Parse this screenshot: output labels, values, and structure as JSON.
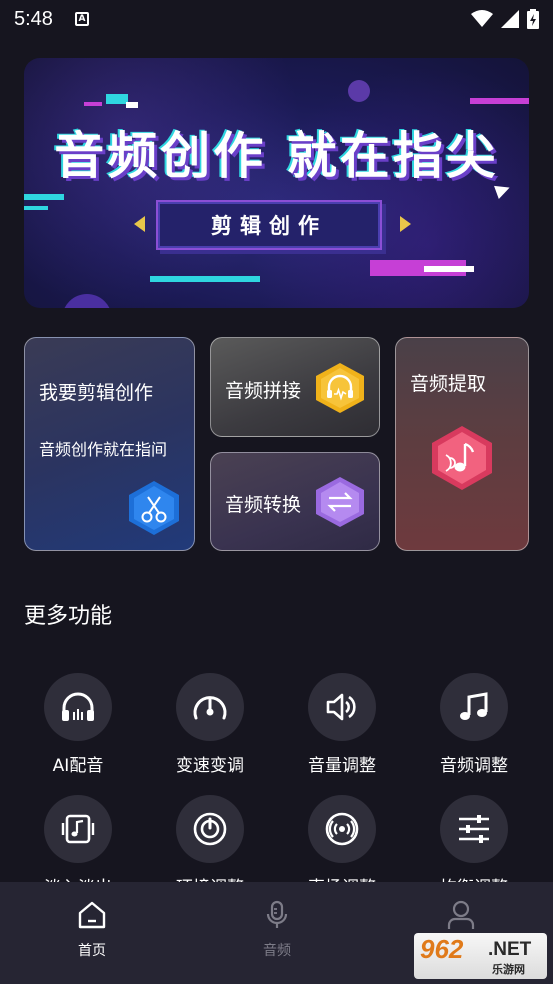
{
  "status": {
    "time": "5:48",
    "notification_icon": "A"
  },
  "banner": {
    "headline": "音频创作  就在指尖",
    "sub": "剪辑创作"
  },
  "cards": {
    "edit": {
      "title": "我要剪辑创作",
      "desc": "音频创作就在指间",
      "icon": "scissors-icon",
      "icon_color": "#1d6fd8"
    },
    "splice": {
      "title": "音频拼接",
      "icon": "headphones-wave-icon",
      "icon_color": "#f0b21a"
    },
    "convert": {
      "title": "音频转换",
      "icon": "swap-arrows-icon",
      "icon_color": "#9a6ae0"
    },
    "extract": {
      "title": "音频提取",
      "icon": "music-note-icon",
      "icon_color": "#e84a6e"
    }
  },
  "more": {
    "title": "更多功能",
    "items": [
      {
        "label": "AI配音",
        "icon": "headphones-icon"
      },
      {
        "label": "变速变调",
        "icon": "speedometer-icon"
      },
      {
        "label": "音量调整",
        "icon": "volume-icon"
      },
      {
        "label": "音频调整",
        "icon": "music-note-icon"
      },
      {
        "label": "淡入淡出",
        "icon": "fade-music-icon"
      },
      {
        "label": "环境调整",
        "icon": "power-dial-icon"
      },
      {
        "label": "声场调整",
        "icon": "surround-icon"
      },
      {
        "label": "均衡调整",
        "icon": "equalizer-icon"
      }
    ]
  },
  "nav": {
    "items": [
      {
        "label": "首页",
        "icon": "home-icon",
        "active": true
      },
      {
        "label": "音频",
        "icon": "microphone-icon",
        "active": false
      },
      {
        "label": "",
        "icon": "user-icon",
        "active": false
      }
    ]
  },
  "watermark": {
    "main": "962",
    "net": ".NET",
    "sub": "乐游网"
  },
  "colors": {
    "background": "#16151f",
    "nav_bg": "#262533",
    "inactive": "#7d7c88"
  }
}
